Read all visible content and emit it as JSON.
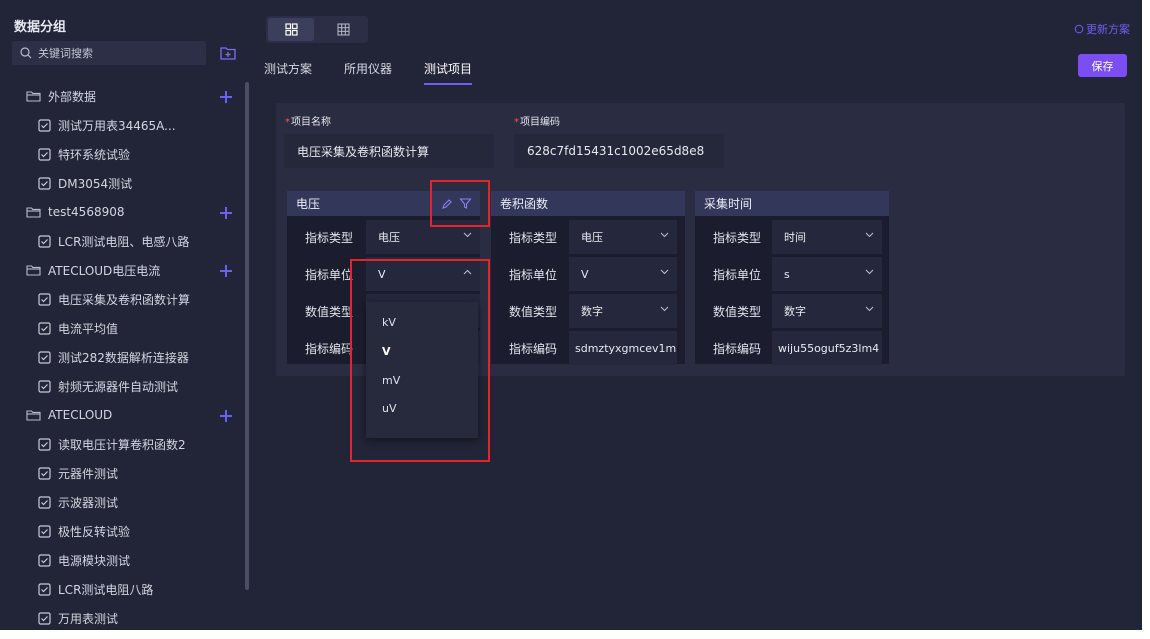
{
  "sidebar": {
    "title": "数据分组",
    "search_placeholder": "关键词搜索",
    "tree": [
      {
        "type": "folder",
        "label": "外部数据",
        "has_add": true
      },
      {
        "type": "leaf",
        "label": "测试万用表34465A..."
      },
      {
        "type": "leaf",
        "label": "特环系统试验"
      },
      {
        "type": "leaf",
        "label": "DM3054测试"
      },
      {
        "type": "folder",
        "label": "test4568908",
        "has_add": true
      },
      {
        "type": "leaf",
        "label": "LCR测试电阻、电感八路"
      },
      {
        "type": "folder",
        "label": "ATECLOUD电压电流",
        "has_add": true
      },
      {
        "type": "leaf",
        "label": "电压采集及卷积函数计算"
      },
      {
        "type": "leaf",
        "label": "电流平均值"
      },
      {
        "type": "leaf",
        "label": "测试282数据解析连接器"
      },
      {
        "type": "leaf",
        "label": "射频无源器件自动测试"
      },
      {
        "type": "folder",
        "label": "ATECLOUD",
        "has_add": true
      },
      {
        "type": "leaf",
        "label": "读取电压计算卷积函数2"
      },
      {
        "type": "leaf",
        "label": "元器件测试"
      },
      {
        "type": "leaf",
        "label": "示波器测试"
      },
      {
        "type": "leaf",
        "label": "极性反转试验"
      },
      {
        "type": "leaf",
        "label": "电源模块测试"
      },
      {
        "type": "leaf",
        "label": "LCR测试电阻八路"
      },
      {
        "type": "leaf",
        "label": "万用表测试"
      }
    ]
  },
  "header": {
    "update_label": "更新方案",
    "save_label": "保存",
    "tabs": [
      {
        "label": "测试方案",
        "active": false
      },
      {
        "label": "所用仪器",
        "active": false
      },
      {
        "label": "测试项目",
        "active": true
      }
    ]
  },
  "form": {
    "name_label": "项目名称",
    "name_value": "电压采集及卷积函数计算",
    "code_label": "项目编码",
    "code_value": "628c7fd15431c1002e65d8e8"
  },
  "cards": [
    {
      "title": "电压",
      "rows": [
        {
          "label": "指标类型",
          "value": "电压"
        },
        {
          "label": "指标单位",
          "value": "V"
        },
        {
          "label": "数值类型",
          "value": ""
        },
        {
          "label": "指标编码",
          "value": ""
        }
      ]
    },
    {
      "title": "卷积函数",
      "rows": [
        {
          "label": "指标类型",
          "value": "电压"
        },
        {
          "label": "指标单位",
          "value": "V"
        },
        {
          "label": "数值类型",
          "value": "数字"
        },
        {
          "label": "指标编码",
          "value": "sdmztyxgmcev1m"
        }
      ]
    },
    {
      "title": "采集时间",
      "rows": [
        {
          "label": "指标类型",
          "value": "时间"
        },
        {
          "label": "指标单位",
          "value": "s"
        },
        {
          "label": "数值类型",
          "value": "数字"
        },
        {
          "label": "指标编码",
          "value": "wiju55oguf5z3lm4"
        }
      ]
    }
  ],
  "unit_dropdown": {
    "options": [
      "kV",
      "V",
      "mV",
      "uV"
    ],
    "selected": "V"
  },
  "colors": {
    "accent": "#7b4df4",
    "link": "#6b61f1",
    "highlight_box": "#e0262b",
    "background": "#222437"
  }
}
